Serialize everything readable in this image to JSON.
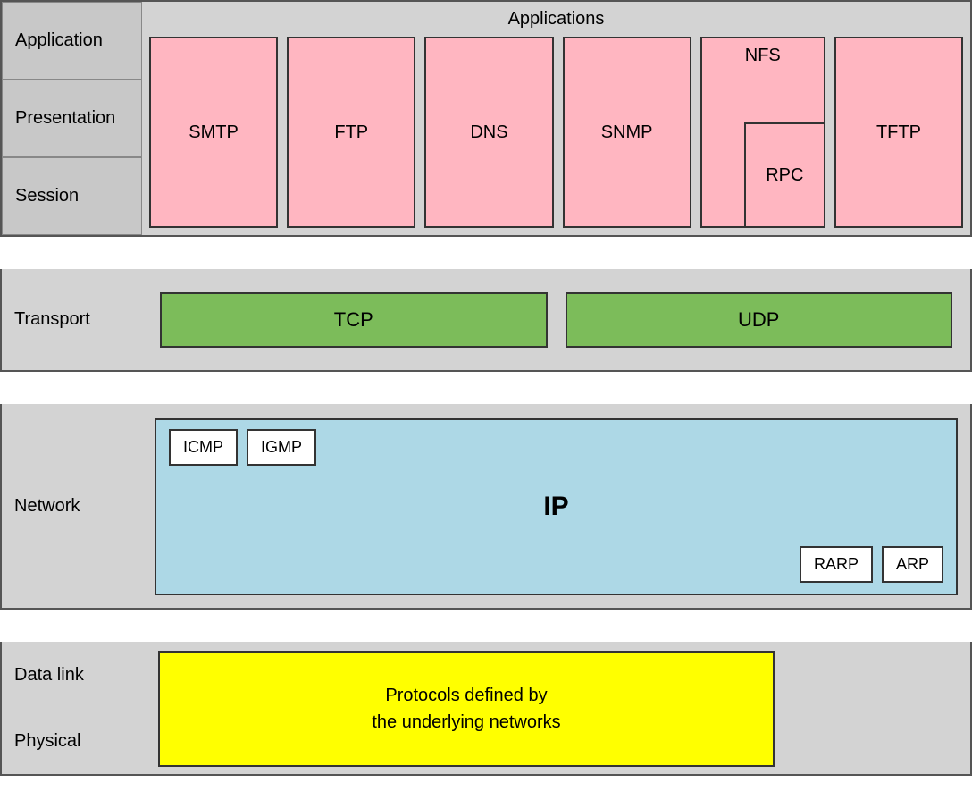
{
  "layers": {
    "application": {
      "labels": [
        "Application",
        "Presentation",
        "Session"
      ],
      "title": "Applications",
      "boxes": [
        "SMTP",
        "FTP",
        "DNS",
        "SNMP"
      ],
      "nfs": "NFS",
      "rpc": "RPC",
      "tftp": "TFTP"
    },
    "transport": {
      "label": "Transport",
      "tcp": "TCP",
      "udp": "UDP"
    },
    "network": {
      "label": "Network",
      "icmp": "ICMP",
      "igmp": "IGMP",
      "ip": "IP",
      "rarp": "RARP",
      "arp": "ARP"
    },
    "datalink": {
      "label": "Data link"
    },
    "physical": {
      "label": "Physical",
      "yellow_text_line1": "Protocols defined by",
      "yellow_text_line2": "the underlying networks"
    }
  }
}
